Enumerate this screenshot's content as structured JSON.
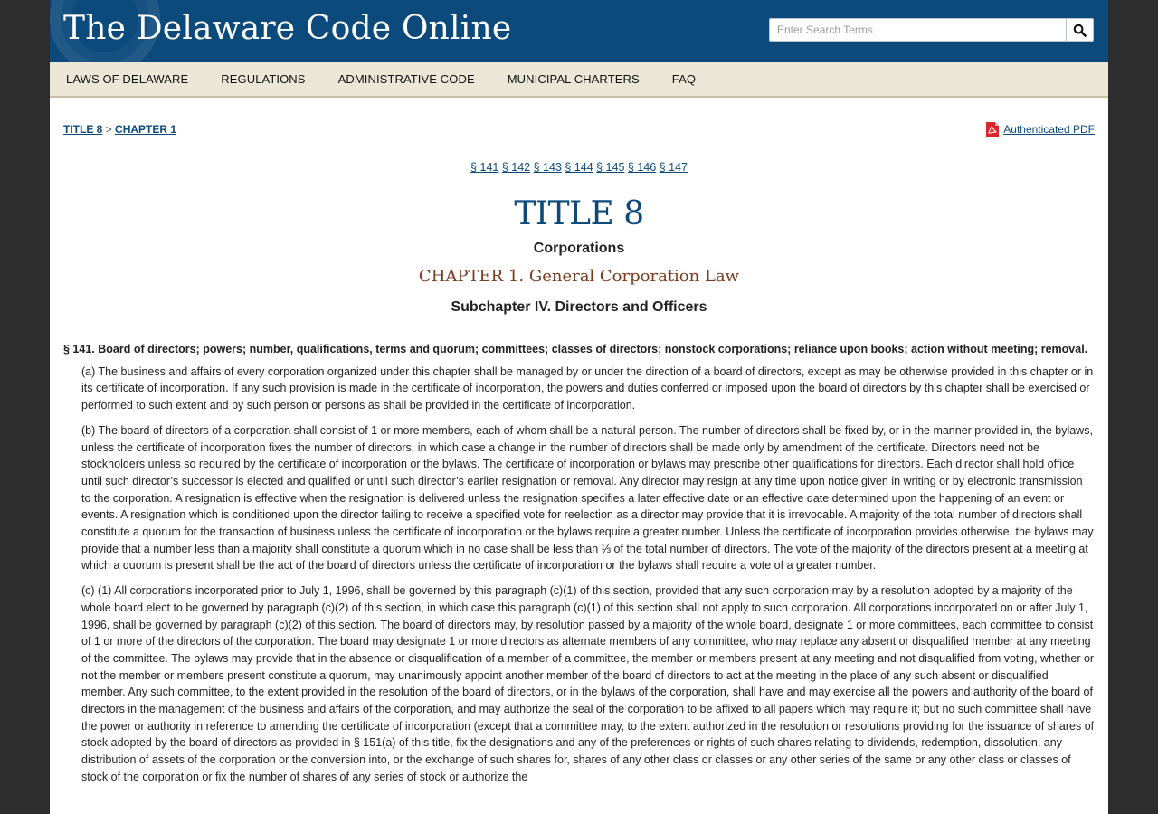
{
  "header": {
    "site_title": "The Delaware Code Online",
    "search_placeholder": "Enter Search Terms"
  },
  "nav": {
    "items": [
      "LAWS OF DELAWARE",
      "REGULATIONS",
      "ADMINISTRATIVE CODE",
      "MUNICIPAL CHARTERS",
      "FAQ"
    ]
  },
  "breadcrumb": {
    "title": "TITLE 8",
    "separator": ">",
    "chapter": "CHAPTER 1"
  },
  "pdf_link": {
    "label": "Authenticated PDF",
    "icon": "pdf-icon"
  },
  "section_links": [
    "§ 141",
    "§ 142",
    "§ 143",
    "§ 144",
    "§ 145",
    "§ 146",
    "§ 147"
  ],
  "doc": {
    "title": "TITLE 8",
    "title_sub": "Corporations",
    "chapter": "CHAPTER 1. General Corporation Law",
    "subchapter": "Subchapter IV. Directors and Officers",
    "section_heading": "§ 141. Board of directors; powers; number, qualifications, terms and quorum; committees; classes of directors; nonstock corporations; reliance upon books; action without meeting; removal.",
    "paragraphs": [
      "(a) The business and affairs of every corporation organized under this chapter shall be managed by or under the direction of a board of directors, except as may be otherwise provided in this chapter or in its certificate of incorporation. If any such provision is made in the certificate of incorporation, the powers and duties conferred or imposed upon the board of directors by this chapter shall be exercised or performed to such extent and by such person or persons as shall be provided in the certificate of incorporation.",
      "(b) The board of directors of a corporation shall consist of 1 or more members, each of whom shall be a natural person. The number of directors shall be fixed by, or in the manner provided in, the bylaws, unless the certificate of incorporation fixes the number of directors, in which case a change in the number of directors shall be made only by amendment of the certificate. Directors need not be stockholders unless so required by the certificate of incorporation or the bylaws. The certificate of incorporation or bylaws may prescribe other qualifications for directors. Each director shall hold office until such director’s successor is elected and qualified or until such director’s earlier resignation or removal. Any director may resign at any time upon notice given in writing or by electronic transmission to the corporation. A resignation is effective when the resignation is delivered unless the resignation specifies a later effective date or an effective date determined upon the happening of an event or events. A resignation which is conditioned upon the director failing to receive a specified vote for reelection as a director may provide that it is irrevocable. A majority of the total number of directors shall constitute a quorum for the transaction of business unless the certificate of incorporation or the bylaws require a greater number. Unless the certificate of incorporation provides otherwise, the bylaws may provide that a number less than a majority shall constitute a quorum which in no case shall be less than ⅓ of the total number of directors. The vote of the majority of the directors present at a meeting at which a quorum is present shall be the act of the board of directors unless the certificate of incorporation or the bylaws shall require a vote of a greater number.",
      "(c) (1) All corporations incorporated prior to July 1, 1996, shall be governed by this paragraph (c)(1) of this section, provided that any such corporation may by a resolution adopted by a majority of the whole board elect to be governed by paragraph (c)(2) of this section, in which case this paragraph (c)(1) of this section shall not apply to such corporation. All corporations incorporated on or after July 1, 1996, shall be governed by paragraph (c)(2) of this section. The board of directors may, by resolution passed by a majority of the whole board, designate 1 or more committees, each committee to consist of 1 or more of the directors of the corporation. The board may designate 1 or more directors as alternate members of any committee, who may replace any absent or disqualified member at any meeting of the committee. The bylaws may provide that in the absence or disqualification of a member of a committee, the member or members present at any meeting and not disqualified from voting, whether or not the member or members present constitute a quorum, may unanimously appoint another member of the board of directors to act at the meeting in the place of any such absent or disqualified member. Any such committee, to the extent provided in the resolution of the board of directors, or in the bylaws of the corporation, shall have and may exercise all the powers and authority of the board of directors in the management of the business and affairs of the corporation, and may authorize the seal of the corporation to be affixed to all papers which may require it; but no such committee shall have the power or authority in reference to amending the certificate of incorporation (except that a committee may, to the extent authorized in the resolution or resolutions providing for the issuance of shares of stock adopted by the board of directors as provided in §  151(a) of this title, fix the designations and any of the preferences or rights of such shares relating to dividends, redemption, dissolution, any distribution of assets of the corporation or the conversion into, or the exchange of such shares for, shares of any other class or classes or any other series of the same or any other class or classes of stock of the corporation or fix the number of shares of any series of stock or authorize the"
    ]
  },
  "colors": {
    "header_bg": "#0d4a7c",
    "nav_bg": "#ece6d6",
    "link": "#0d4a7c",
    "chapter": "#7a3a1c",
    "pdf_red": "#d9262b",
    "page_outer": "#2d2d2d"
  }
}
